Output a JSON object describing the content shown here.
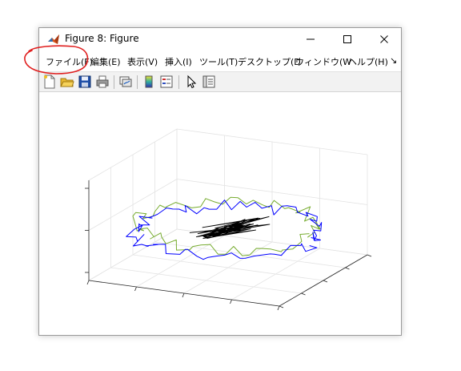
{
  "window": {
    "title": "Figure 8: Figure"
  },
  "menu": {
    "items": [
      "ファイル(F)",
      "編集(E)",
      "表示(V)",
      "挿入(I)",
      "ツール(T)",
      "デスクトップ(D",
      "ウィンドウ(W",
      "ヘルプ(H)"
    ],
    "overflow": "↘"
  },
  "toolbar": {
    "icons": [
      "new-figure-icon",
      "open-file-icon",
      "save-icon",
      "print-icon",
      "link-plot-icon",
      "colorbar-icon",
      "legend-icon",
      "edit-plot-pointer-icon",
      "property-inspector-icon"
    ]
  },
  "annotation": {
    "color": "#e02020",
    "target": "menu-file"
  },
  "colors": {
    "ring_green": "#77ac30",
    "ring_blue": "#0000ff",
    "core_black": "#000000",
    "grid": "#e3e3e3",
    "axis": "#262626"
  }
}
